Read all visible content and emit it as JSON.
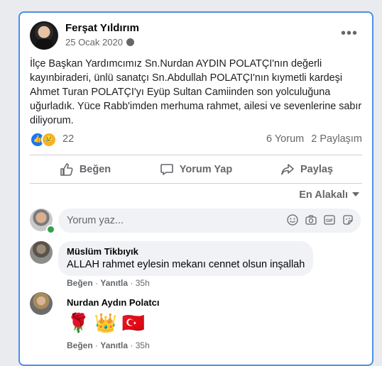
{
  "post": {
    "author": "Ferşat Yıldırım",
    "date": "25 Ocak 2020",
    "body": "İlçe Başkan Yardımcımız Sn.Nurdan AYDIN POLATÇI'nın değerli kayınbiraderi, ünlü sanatçı Sn.Abdullah POLATÇI'nın kıymetli kardeşi Ahmet Turan POLATÇI'yı Eyüp Sultan Camiinden son yolculuğuna uğurladık. Yüce Rabb'imden merhuma rahmet, ailesi ve sevenlerine sabır diliyorum.",
    "reactions_count": "22",
    "comments_count": "6 Yorum",
    "shares_count": "2 Paylaşım",
    "more_label": "•••"
  },
  "actions": {
    "like": "Beğen",
    "comment": "Yorum Yap",
    "share": "Paylaş"
  },
  "sort_label": "En Alakalı",
  "composer": {
    "placeholder": "Yorum yaz..."
  },
  "comments": [
    {
      "name": "Müslüm Tikbıyık",
      "text": "ALLAH rahmet eylesin mekanı cennet olsun inşallah",
      "like": "Beğen",
      "reply": "Yanıtla",
      "time": "35h"
    },
    {
      "name": "Nurdan Aydın Polatcı",
      "emojis": [
        "🌹",
        "👑",
        "🇹🇷"
      ],
      "like": "Beğen",
      "reply": "Yanıtla",
      "time": "35h"
    }
  ],
  "colors": {
    "accent": "#1877f2",
    "border": "#4d8fe8",
    "muted": "#65676b"
  }
}
